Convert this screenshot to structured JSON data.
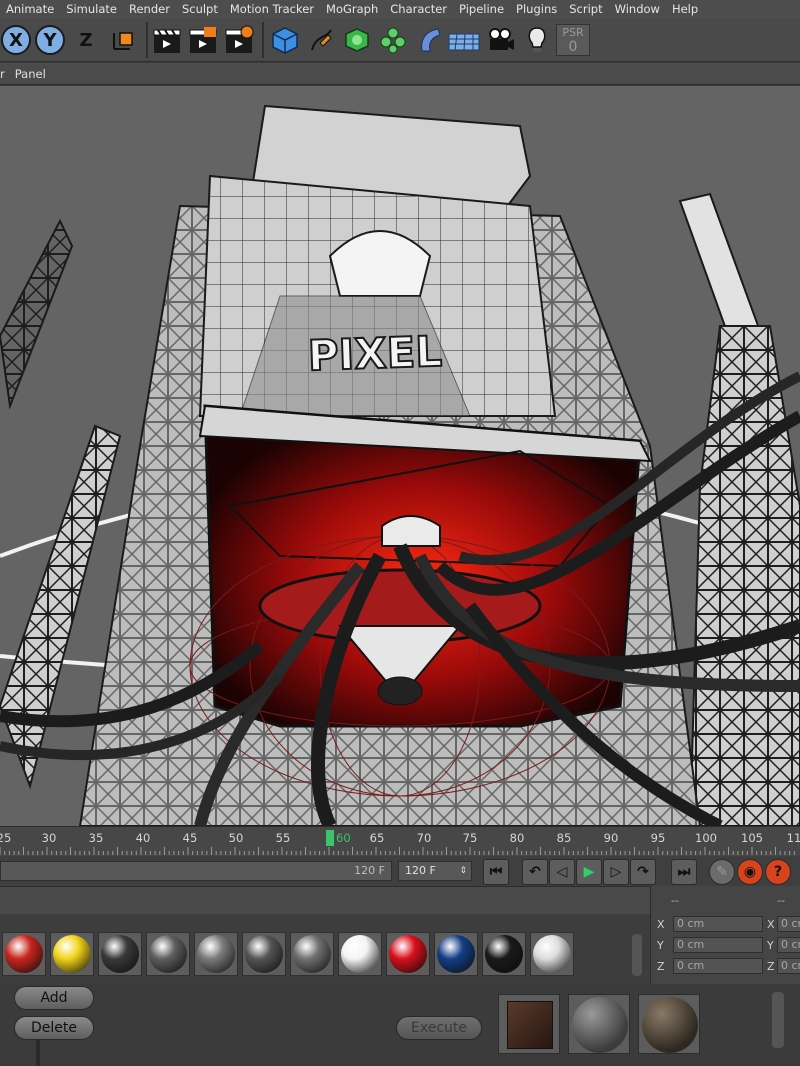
{
  "menubar": {
    "items": [
      "Animate",
      "Simulate",
      "Render",
      "Sculpt",
      "Motion Tracker",
      "MoGraph",
      "Character",
      "Pipeline",
      "Plugins",
      "Script",
      "Window",
      "Help"
    ]
  },
  "toolbar": {
    "axis_x": "X",
    "axis_y": "Y",
    "axis_z": "Z",
    "psr_label": "PSR",
    "psr_value": "0"
  },
  "viewport_menu": {
    "items": [
      "r",
      "Panel"
    ]
  },
  "viewport": {
    "logo_text": "PIXEL"
  },
  "timeline": {
    "ticks": [
      "25",
      "30",
      "35",
      "40",
      "45",
      "50",
      "55",
      "60",
      "65",
      "70",
      "75",
      "80",
      "85",
      "90",
      "95",
      "100",
      "105",
      "11"
    ],
    "current_frame": "60"
  },
  "transport": {
    "end_frame_display": "120 F",
    "max_frame_field": "120 F"
  },
  "coordinates": {
    "header_dash": "--",
    "header_dash2": "--",
    "rows": [
      {
        "axis": "X",
        "value": "0 cm",
        "axis2": "X",
        "value2": "0 cr"
      },
      {
        "axis": "Y",
        "value": "0 cm",
        "axis2": "Y",
        "value2": "0 cr"
      },
      {
        "axis": "Z",
        "value": "0 cm",
        "axis2": "Z",
        "value2": "0 cr"
      }
    ]
  },
  "material_manager": {
    "add_label": "Add",
    "delete_label": "Delete",
    "execute_label": "Execute",
    "materials": [
      {
        "color": "#c8261d"
      },
      {
        "color": "#f2d41a"
      },
      {
        "color": "#3a3a3a"
      },
      {
        "color": "#5e5e5e"
      },
      {
        "color": "#7a7a7a"
      },
      {
        "color": "#555555"
      },
      {
        "color": "#707070"
      },
      {
        "color": "#f4f4f4"
      },
      {
        "color": "#d8101c"
      },
      {
        "color": "#143e86"
      },
      {
        "color": "#1a1a1a"
      },
      {
        "color": "#dcdcdc"
      }
    ]
  },
  "colors": {
    "accent_blue": "#7faee4",
    "playhead_green": "#3cc46a",
    "viewport_bg": "#646464",
    "red_glow": "#b01010"
  }
}
